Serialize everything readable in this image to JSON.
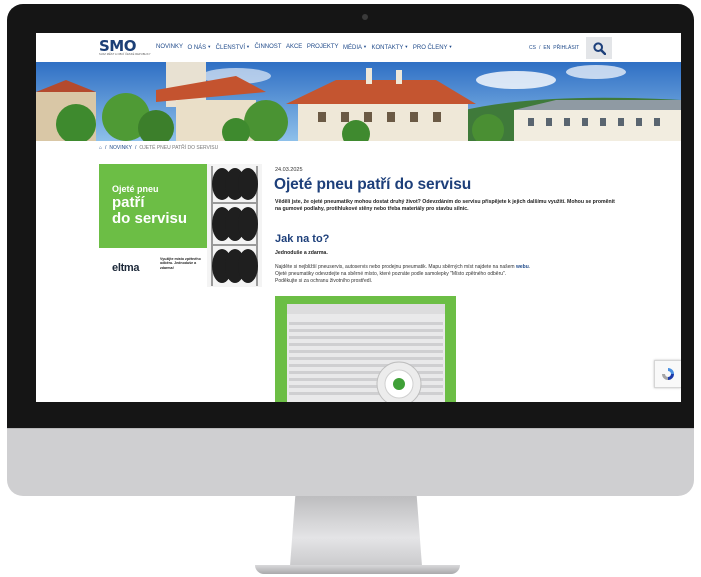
{
  "logo": {
    "text": "SMO",
    "tagline": "SVAZ MĚST A OBCÍ ČESKÉ REPUBLIKY"
  },
  "nav": {
    "items": [
      {
        "label": "NOVINKY",
        "dropdown": false
      },
      {
        "label": "O NÁS",
        "dropdown": true
      },
      {
        "label": "ČLENSTVÍ",
        "dropdown": true
      },
      {
        "label": "ČINNOST",
        "dropdown": false
      },
      {
        "label": "AKCE",
        "dropdown": false
      },
      {
        "label": "PROJEKTY",
        "dropdown": false
      },
      {
        "label": "MÉDIA",
        "dropdown": true
      },
      {
        "label": "KONTAKTY",
        "dropdown": true
      },
      {
        "label": "PRO ČLENY",
        "dropdown": true
      }
    ],
    "lang_cs": "CS",
    "lang_sep": "/",
    "lang_en": "EN",
    "login": "PŘIHLÁSIT",
    "search_icon": "search-icon"
  },
  "breadcrumb": {
    "home_icon": "home-icon",
    "sep": "/",
    "parent": "NOVINKY",
    "current": "OJETÉ PNEU PATŘÍ DO SERVISU"
  },
  "banner": {
    "line1": "Ojeté pneu",
    "line2": "patří",
    "line3": "do servisu",
    "brand": "eltma",
    "note": "Využijte místo zpětného odběru. Jednoduše a zdarma!"
  },
  "article": {
    "date": "24.03.2025",
    "title": "Ojeté pneu patří do servisu",
    "lead": "Věděli jste, že ojeté pneumatiky mohou dostat druhý život? Odevzdáním do servisu přispějete k jejich dalšímu využití. Mohou se proměnit na gumové podlahy, protihlukové stěny nebo třeba materiály pro stavbu silnic.",
    "heading": "Jak na to?",
    "subheading": "Jednoduše a zdarma.",
    "para1_a": "Najděte si nejbližší pneuservis, autoservis nebo prodejnu pneumatik. Mapu sběrných míst najdete na našem ",
    "para1_link": "webu",
    "para1_b": ".",
    "para2": "Ojeté pneumatiky odevzdejte na sběrné místo, které poznáte podle samolepky \"Místo zpětného odběru\".",
    "para3": "Poděkujte si za ochranu životního prostředí."
  },
  "colors": {
    "brand_blue": "#1d3f7a",
    "green": "#6cbe45",
    "bezel": "#151515"
  }
}
